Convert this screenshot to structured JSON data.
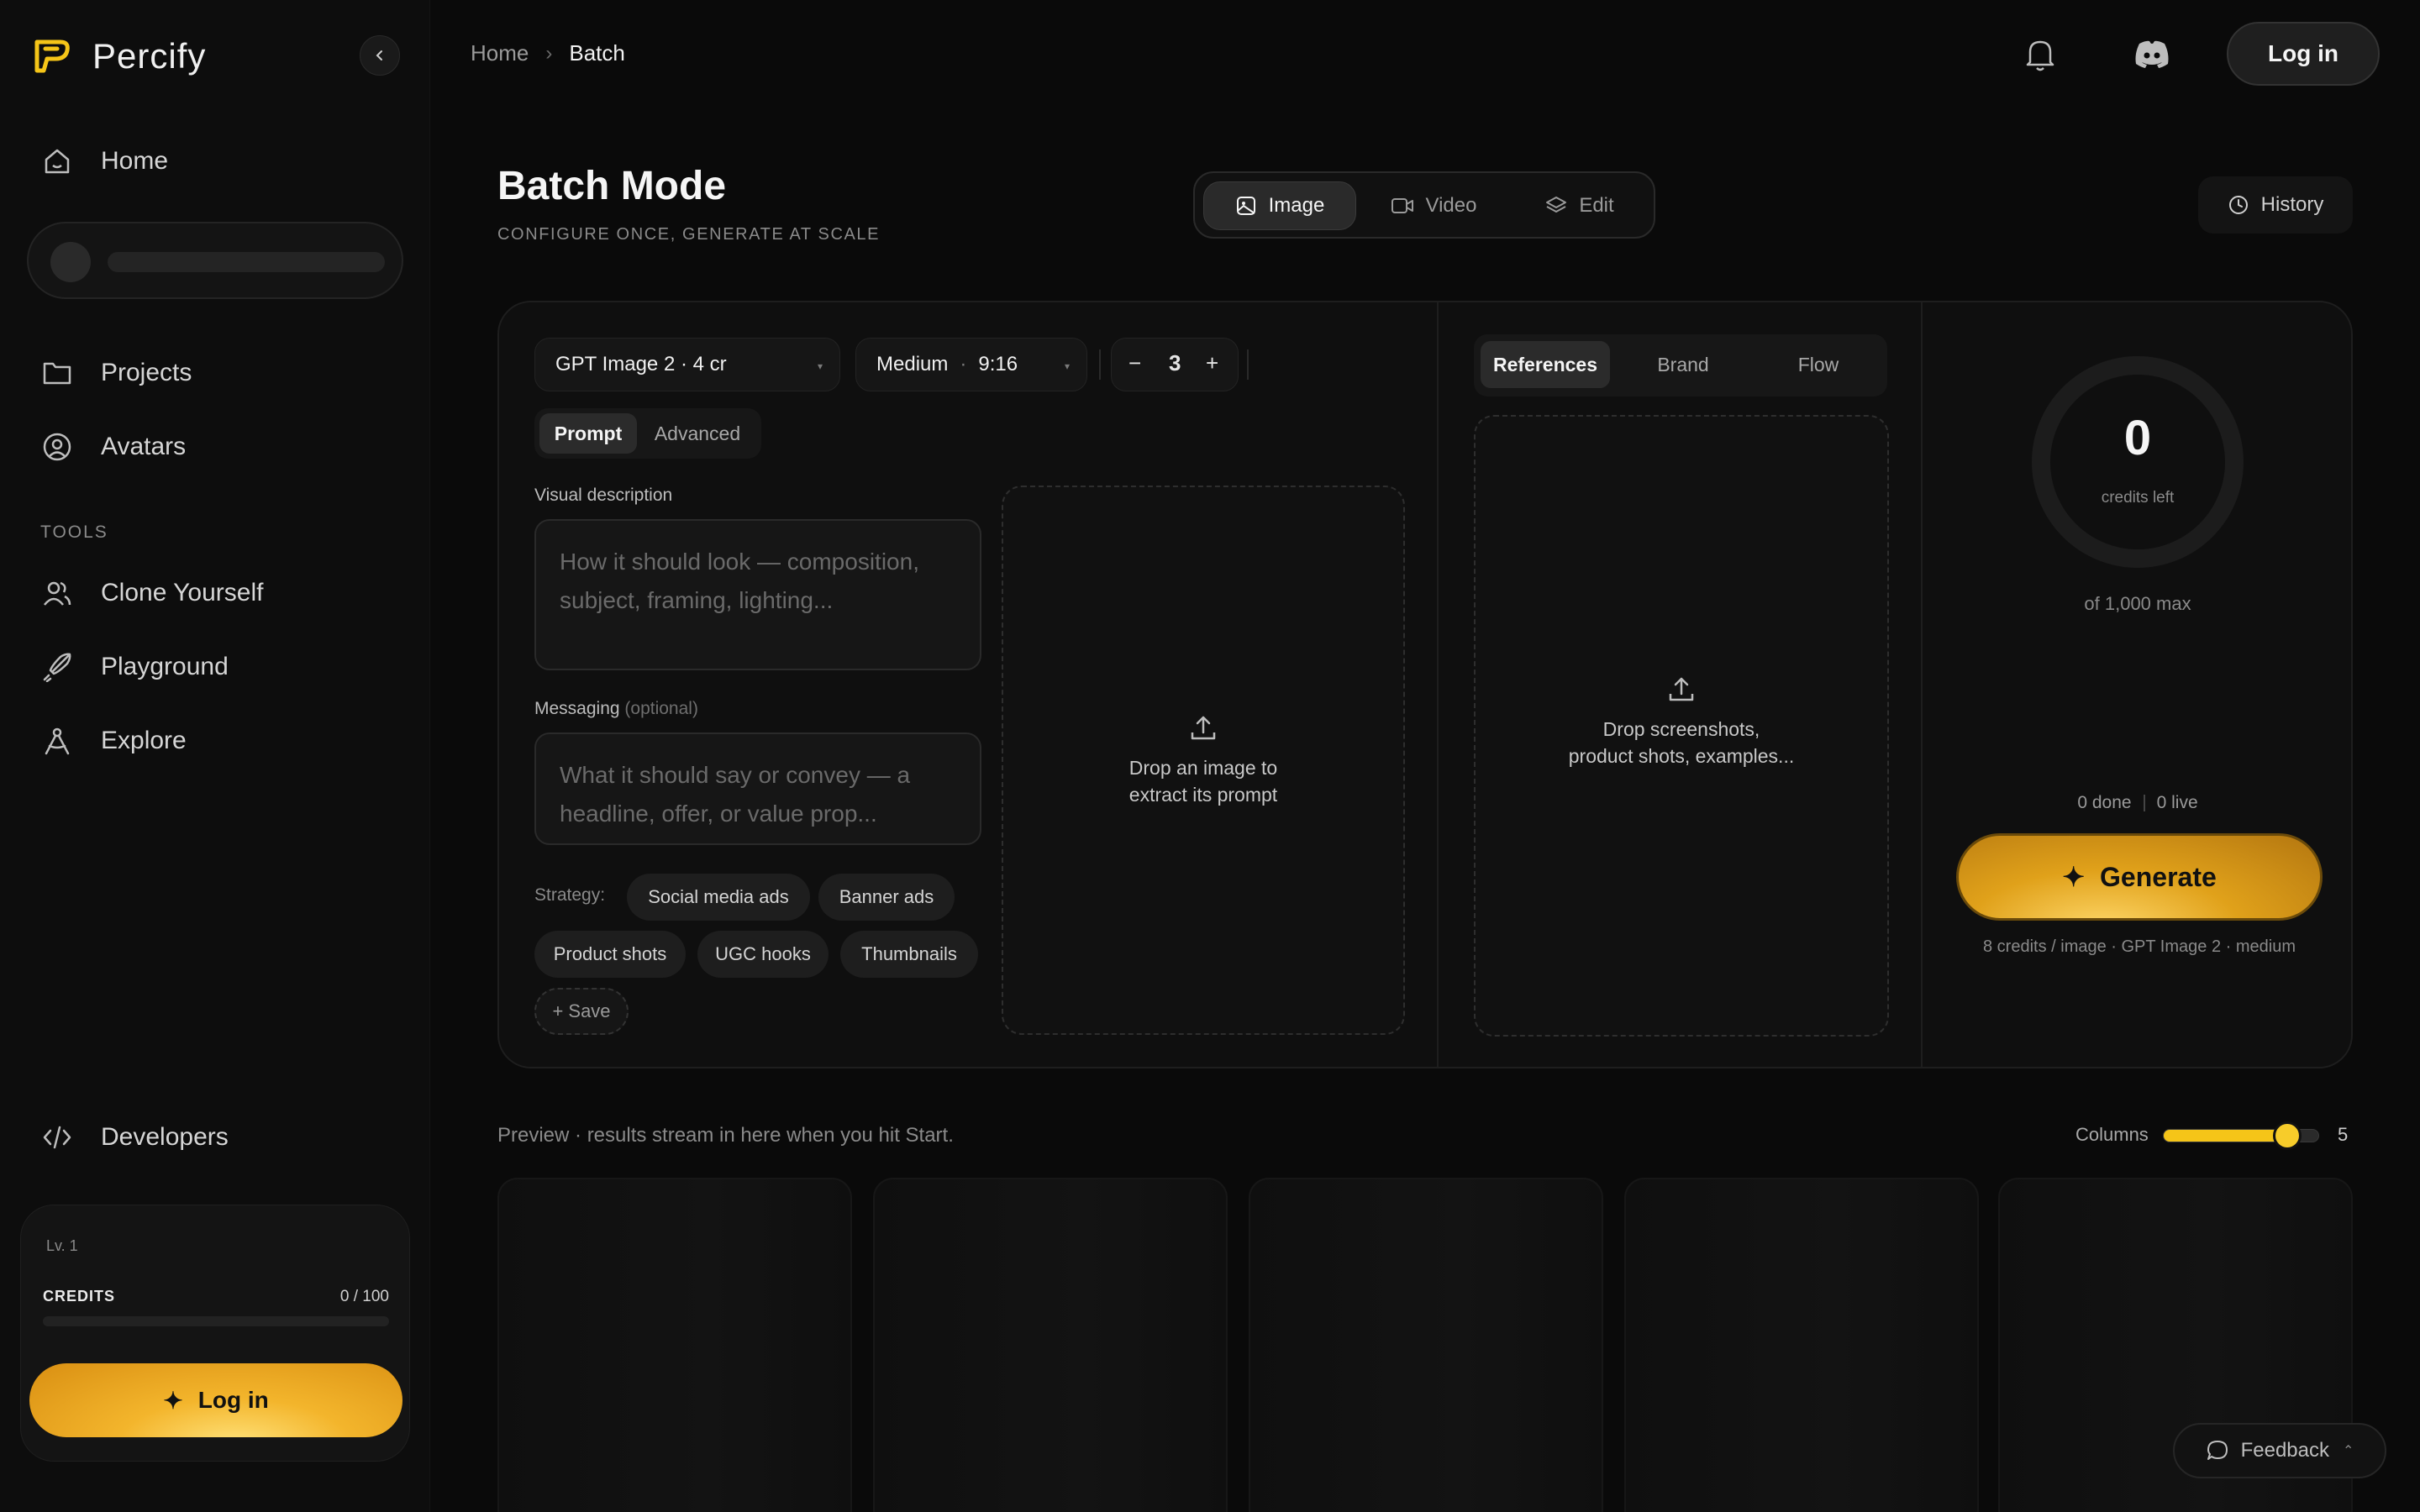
{
  "app": {
    "name": "Percify"
  },
  "breadcrumb": {
    "home": "Home",
    "current": "Batch"
  },
  "topbar": {
    "login_label": "Log in"
  },
  "sidebar": {
    "nav": [
      {
        "label": "Home",
        "icon": "home-icon"
      },
      {
        "label": "Projects",
        "icon": "folder-icon"
      },
      {
        "label": "Avatars",
        "icon": "user-circle-icon"
      }
    ],
    "tools_label": "TOOLS",
    "tools": [
      {
        "label": "Clone Yourself",
        "icon": "users-icon"
      },
      {
        "label": "Playground",
        "icon": "rocket-icon"
      },
      {
        "label": "Explore",
        "icon": "compass-icon"
      }
    ],
    "developers_label": "Developers",
    "credits_card": {
      "level": "Lv. 1",
      "credits_label": "CREDITS",
      "credits_value": "0 / 100",
      "credits_progress": 0,
      "login_label": "Log in"
    }
  },
  "header": {
    "title": "Batch Mode",
    "subtitle": "CONFIGURE ONCE, GENERATE AT SCALE",
    "mode_tabs": [
      {
        "label": "Image",
        "icon": "image-icon",
        "active": true
      },
      {
        "label": "Video",
        "icon": "video-icon",
        "active": false
      },
      {
        "label": "Edit",
        "icon": "layers-icon",
        "active": false
      }
    ],
    "history_label": "History"
  },
  "config": {
    "model_select": "GPT Image 2 · 4 cr",
    "quality_select": "Medium",
    "ratio_select": "9:16",
    "count": "3",
    "minus": "−",
    "plus": "+",
    "prompt_tabs": [
      "Prompt",
      "Advanced"
    ],
    "visual_label": "Visual description",
    "visual_placeholder": "How it should look — composition, subject, framing, lighting...",
    "messaging_label": "Messaging",
    "messaging_optional": "(optional)",
    "messaging_placeholder": "What it should say or convey — a headline, offer, or value prop...",
    "extract_line1": "Drop an image to",
    "extract_line2": "extract its prompt",
    "strategy_label": "Strategy:",
    "strategy_chips": [
      "Social media ads",
      "Banner ads",
      "Product shots",
      "UGC hooks",
      "Thumbnails"
    ],
    "save_chip": "+ Save"
  },
  "references": {
    "tabs": [
      "References",
      "Brand",
      "Flow"
    ],
    "drop_line1": "Drop screenshots,",
    "drop_line2": "product shots, examples..."
  },
  "generate_panel": {
    "credits_value": "0",
    "credits_label": "credits left",
    "max_label": "of 1,000 max",
    "done": "0 done",
    "live": "0 live",
    "generate_label": "Generate",
    "note": "8 credits / image · GPT Image 2 · medium"
  },
  "preview": {
    "note": "Preview · results stream in here when you hit Start.",
    "columns_label": "Columns",
    "columns_value": "5",
    "columns_min": 1,
    "columns_max": 6
  },
  "feedback_label": "Feedback",
  "colors": {
    "accent": "#f5c518",
    "gold_button": "#e0a11a",
    "background": "#0a0a0a"
  }
}
